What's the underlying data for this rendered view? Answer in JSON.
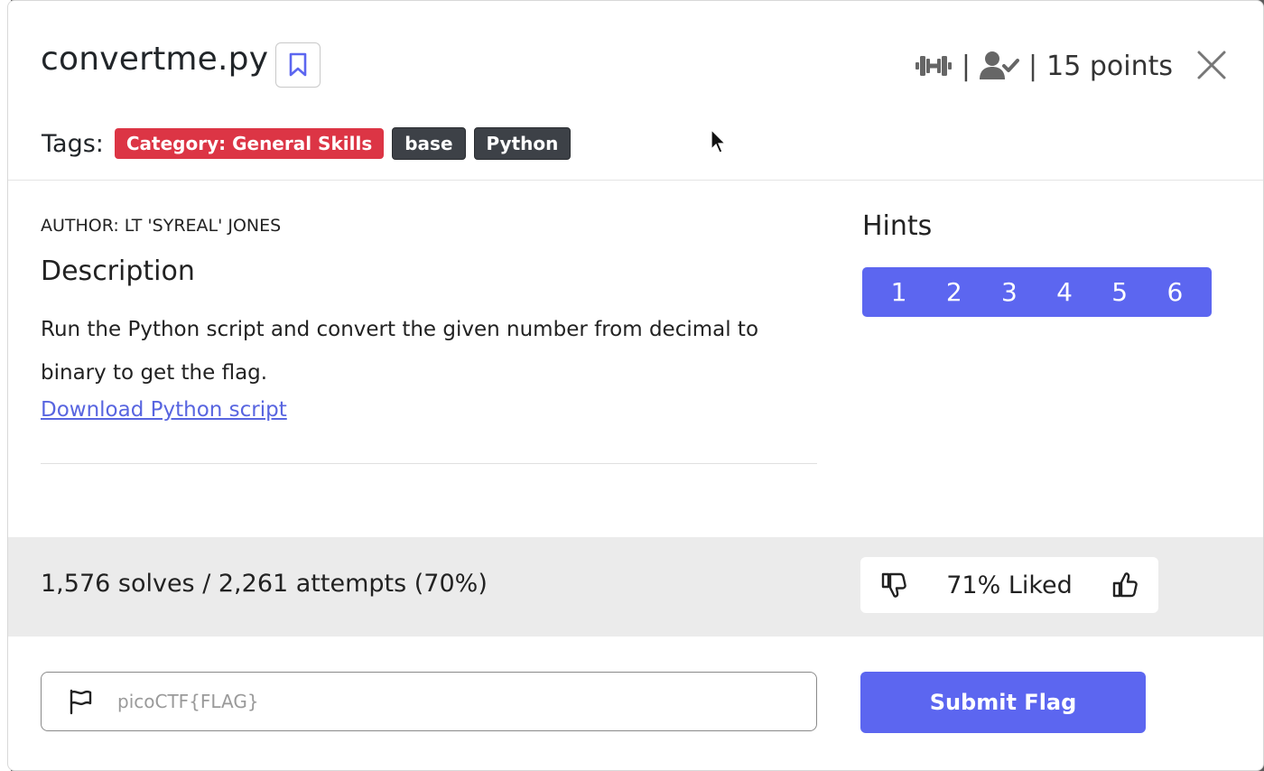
{
  "modal": {
    "title": "convertme.py",
    "points_label": "15 points",
    "separator": "|",
    "tags_label": "Tags:",
    "tags": [
      {
        "label": "Category: General Skills",
        "color": "#dc3545"
      },
      {
        "label": "base",
        "color": "#3d4147"
      },
      {
        "label": "Python",
        "color": "#3d4147"
      }
    ],
    "icons": {
      "bookmark": "bookmark-icon",
      "difficulty": "dumbbell-icon",
      "solved_by": "user-check-icon",
      "close": "close-icon"
    }
  },
  "content": {
    "author": "AUTHOR: LT 'SYREAL' JONES",
    "description_heading": "Description",
    "description": "Run the Python script and convert the given number from decimal to binary to get the flag.",
    "download_link": "Download Python script"
  },
  "hints": {
    "heading": "Hints",
    "items": [
      "1",
      "2",
      "3",
      "4",
      "5",
      "6"
    ]
  },
  "stats": {
    "solves_text": "1,576 solves / 2,261 attempts (70%)",
    "liked_text": "71% Liked"
  },
  "submit": {
    "placeholder": "picoCTF{FLAG}",
    "value": "",
    "button_label": "Submit Flag"
  },
  "colors": {
    "accent": "#5c66f0",
    "category_tag": "#dc3545",
    "dark_tag": "#3d4147",
    "link": "#5865e0"
  }
}
